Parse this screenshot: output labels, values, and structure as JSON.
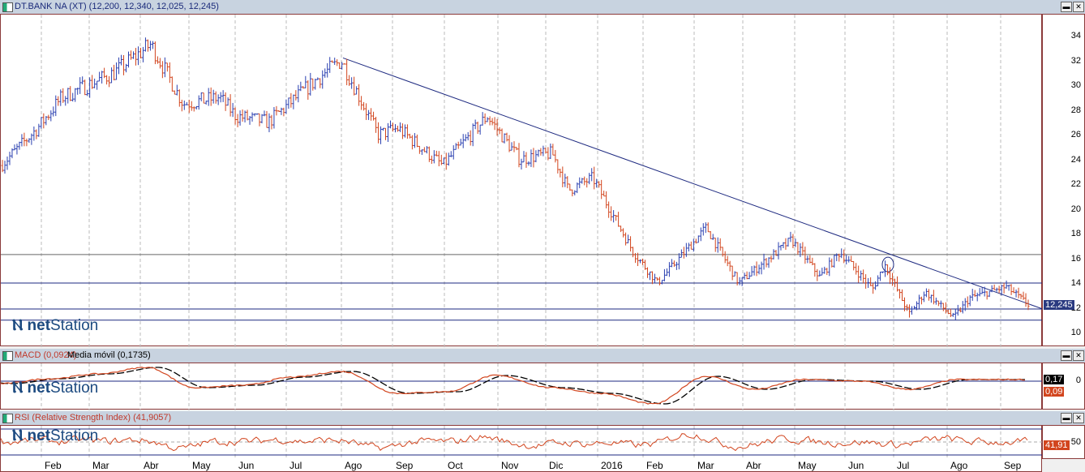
{
  "price_panel": {
    "title": "DT.BANK NA (XT) (12,200, 12,340, 12,025, 12,245)",
    "last": "12,245",
    "ticks": [
      "34",
      "32",
      "30",
      "28",
      "26",
      "24",
      "22",
      "20",
      "18",
      "16",
      "14",
      "12",
      "10"
    ]
  },
  "macd_panel": {
    "title_macd": "MACD (0,0924)",
    "sep": " - ",
    "title_signal": "Media móvil (0,1735)",
    "signal_tag": "0,17",
    "macd_tag": "0,09",
    "zero": "0"
  },
  "rsi_panel": {
    "title": "RSI (Relative Strength Index) (41,9057)",
    "tag": "41,91",
    "mid": "50"
  },
  "logo": {
    "text_bold": "net",
    "text": "Station"
  },
  "months": [
    "Feb",
    "Mar",
    "Abr",
    "May",
    "Jun",
    "Jul",
    "Ago",
    "Sep",
    "Oct",
    "Nov",
    "Dic",
    "2016",
    "Feb",
    "Mar",
    "Abr",
    "May",
    "Jun",
    "Jul",
    "Ago",
    "Sep"
  ],
  "colors": {
    "up": "#2a3fb0",
    "down": "#d2451e",
    "macd": "#d2451e",
    "signal": "#000000",
    "line": "#1e2a80"
  },
  "chart_data": {
    "type": "line",
    "title": "DT.BANK NA (XT)",
    "ylim": [
      9.5,
      35.5
    ],
    "price_keypoints": [
      [
        0,
        23.5
      ],
      [
        1,
        26.5
      ],
      [
        2,
        29
      ],
      [
        3,
        31
      ],
      [
        4,
        33.3
      ],
      [
        5,
        28.5
      ],
      [
        6,
        29
      ],
      [
        7,
        27.5
      ],
      [
        8,
        27
      ],
      [
        9,
        30.5
      ],
      [
        10,
        32
      ],
      [
        11,
        26
      ],
      [
        12,
        26.5
      ],
      [
        13,
        23.5
      ],
      [
        14,
        27.5
      ],
      [
        15,
        24
      ],
      [
        16,
        24.5
      ],
      [
        17,
        21.5
      ],
      [
        18,
        22.5
      ],
      [
        19,
        16.5
      ],
      [
        20,
        14
      ],
      [
        21,
        15.5
      ],
      [
        22,
        18.5
      ],
      [
        23,
        14
      ],
      [
        24,
        17.5
      ],
      [
        25,
        14.5
      ],
      [
        26,
        16.5
      ],
      [
        27,
        13.5
      ],
      [
        28,
        15.5
      ],
      [
        29,
        11.5
      ],
      [
        30,
        13.3
      ],
      [
        31,
        11.2
      ],
      [
        32,
        12.8
      ],
      [
        33,
        13.7
      ],
      [
        34,
        12.2
      ]
    ],
    "horizontal_lines": [
      16.3,
      14,
      11.9,
      11
    ],
    "trendline": [
      [
        32.2,
        "Ago"
      ],
      [
        11.9,
        "Sep"
      ]
    ],
    "macd_range": [
      -3,
      2
    ],
    "rsi_levels": [
      70,
      50,
      30
    ]
  }
}
